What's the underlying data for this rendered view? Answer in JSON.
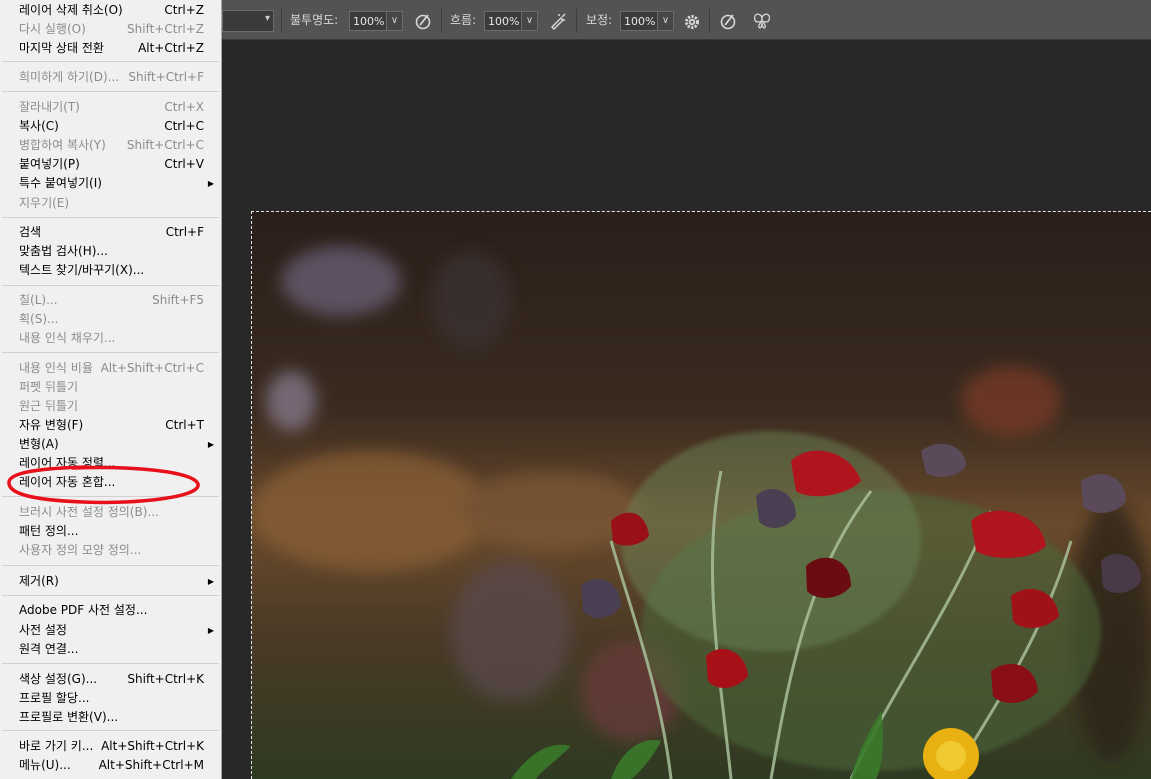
{
  "options_bar": {
    "opacity_label": "불투명도:",
    "opacity_value": "100%",
    "flow_label": "흐름:",
    "flow_value": "100%",
    "smoothing_label": "보정:",
    "smoothing_value": "100%",
    "icons": [
      "pressure-opacity-icon",
      "airbrush-icon",
      "gear-icon",
      "pressure-size-icon",
      "symmetry-butterfly-icon"
    ]
  },
  "edit_menu": {
    "items": [
      {
        "label": "레이어 삭제 취소(O)",
        "shortcut": "Ctrl+Z",
        "enabled": true,
        "submenu": false
      },
      {
        "label": "다시 실행(O)",
        "shortcut": "Shift+Ctrl+Z",
        "enabled": false,
        "submenu": false
      },
      {
        "label": "마지막 상태 전환",
        "shortcut": "Alt+Ctrl+Z",
        "enabled": true,
        "submenu": false
      },
      {
        "label": "희미하게 하기(D)...",
        "shortcut": "Shift+Ctrl+F",
        "enabled": false,
        "submenu": false
      },
      {
        "label": "잘라내기(T)",
        "shortcut": "Ctrl+X",
        "enabled": false,
        "submenu": false
      },
      {
        "label": "복사(C)",
        "shortcut": "Ctrl+C",
        "enabled": true,
        "submenu": false
      },
      {
        "label": "병합하여 복사(Y)",
        "shortcut": "Shift+Ctrl+C",
        "enabled": false,
        "submenu": false
      },
      {
        "label": "붙여넣기(P)",
        "shortcut": "Ctrl+V",
        "enabled": true,
        "submenu": false
      },
      {
        "label": "특수 붙여넣기(I)",
        "shortcut": "",
        "enabled": true,
        "submenu": true
      },
      {
        "label": "지우기(E)",
        "shortcut": "",
        "enabled": false,
        "submenu": false
      },
      {
        "label": "검색",
        "shortcut": "Ctrl+F",
        "enabled": true,
        "submenu": false
      },
      {
        "label": "맞춤법 검사(H)...",
        "shortcut": "",
        "enabled": true,
        "submenu": false
      },
      {
        "label": "텍스트 찾기/바꾸기(X)...",
        "shortcut": "",
        "enabled": true,
        "submenu": false
      },
      {
        "label": "칠(L)...",
        "shortcut": "Shift+F5",
        "enabled": false,
        "submenu": false
      },
      {
        "label": "획(S)...",
        "shortcut": "",
        "enabled": false,
        "submenu": false
      },
      {
        "label": "내용 인식 채우기...",
        "shortcut": "",
        "enabled": false,
        "submenu": false
      },
      {
        "label": "내용 인식 비율",
        "shortcut": "Alt+Shift+Ctrl+C",
        "enabled": false,
        "submenu": false
      },
      {
        "label": "퍼펫 뒤틀기",
        "shortcut": "",
        "enabled": false,
        "submenu": false
      },
      {
        "label": "원근 뒤틀기",
        "shortcut": "",
        "enabled": false,
        "submenu": false
      },
      {
        "label": "자유 변형(F)",
        "shortcut": "Ctrl+T",
        "enabled": true,
        "submenu": false
      },
      {
        "label": "변형(A)",
        "shortcut": "",
        "enabled": true,
        "submenu": true
      },
      {
        "label": "레이어 자동 정렬...",
        "shortcut": "",
        "enabled": true,
        "submenu": false
      },
      {
        "label": "레이어 자동 혼합...",
        "shortcut": "",
        "enabled": true,
        "submenu": false
      },
      {
        "label": "브러시 사전 설정 정의(B)...",
        "shortcut": "",
        "enabled": false,
        "submenu": false
      },
      {
        "label": "패턴 정의...",
        "shortcut": "",
        "enabled": true,
        "submenu": false
      },
      {
        "label": "사용자 정의 모양 정의...",
        "shortcut": "",
        "enabled": false,
        "submenu": false
      },
      {
        "label": "제거(R)",
        "shortcut": "",
        "enabled": true,
        "submenu": true
      },
      {
        "label": "Adobe PDF 사전 설정...",
        "shortcut": "",
        "enabled": true,
        "submenu": false
      },
      {
        "label": "사전 설정",
        "shortcut": "",
        "enabled": true,
        "submenu": true
      },
      {
        "label": "원격 연결...",
        "shortcut": "",
        "enabled": true,
        "submenu": false
      },
      {
        "label": "색상 설정(G)...",
        "shortcut": "Shift+Ctrl+K",
        "enabled": true,
        "submenu": false
      },
      {
        "label": "프로필 할당...",
        "shortcut": "",
        "enabled": true,
        "submenu": false
      },
      {
        "label": "프로필로 변환(V)...",
        "shortcut": "",
        "enabled": true,
        "submenu": false
      },
      {
        "label": "바로 가기 키...",
        "shortcut": "Alt+Shift+Ctrl+K",
        "enabled": true,
        "submenu": false
      },
      {
        "label": "메뉴(U)...",
        "shortcut": "Alt+Shift+Ctrl+M",
        "enabled": true,
        "submenu": false
      }
    ]
  },
  "highlight": {
    "item": "레이어 자동 혼합...",
    "color": "#e8101a"
  },
  "colors": {
    "menu_bg": "#f0f0f0",
    "options_bar_bg": "#535353",
    "workspace_bg": "#282828",
    "flower_red": "#b0141c",
    "dandelion_yellow": "#e8b010"
  }
}
